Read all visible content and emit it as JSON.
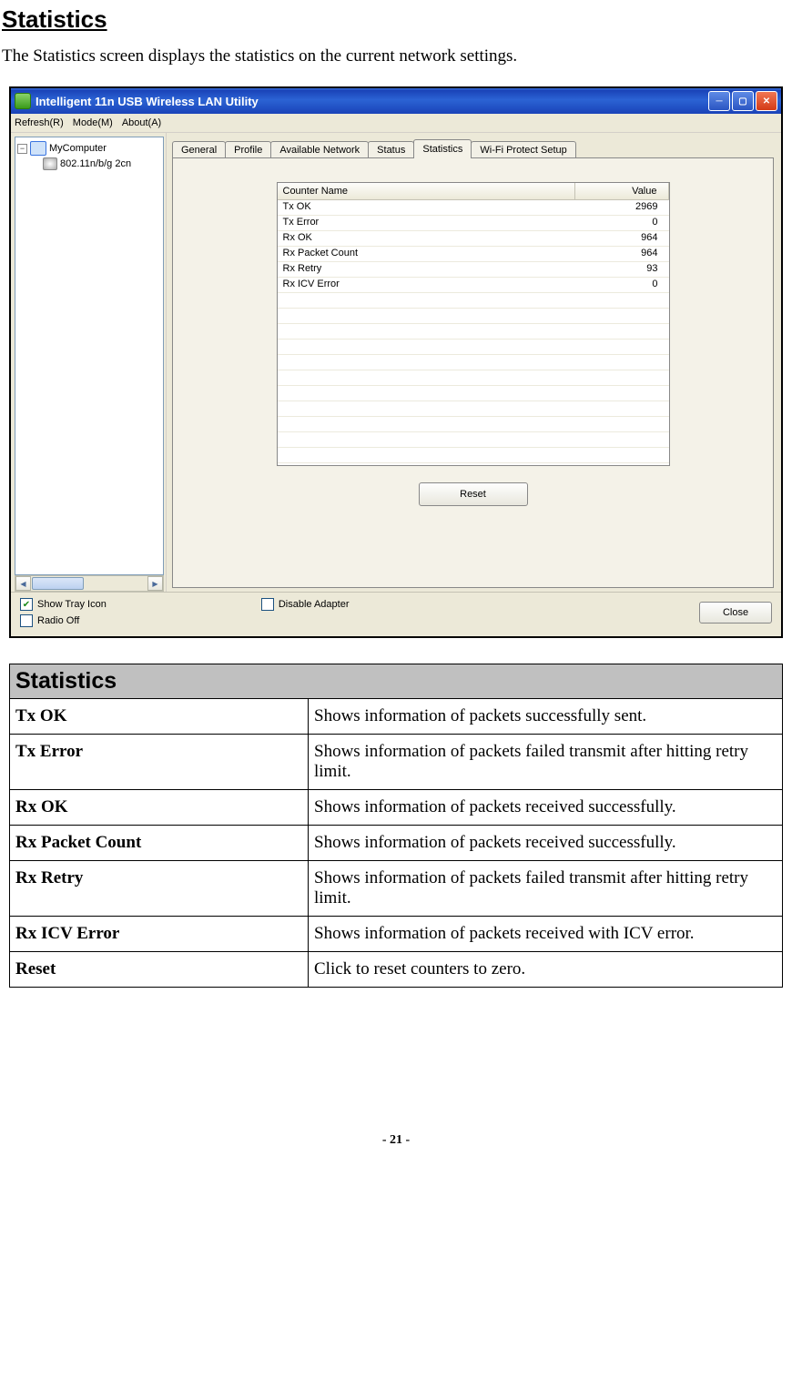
{
  "page": {
    "heading": "Statistics",
    "intro": "The Statistics screen displays the statistics on the current network settings.",
    "page_number": "- 21 -"
  },
  "window": {
    "title": "Intelligent 11n USB Wireless LAN Utility",
    "menu": {
      "refresh": "Refresh(R)",
      "mode": "Mode(M)",
      "about": "About(A)"
    },
    "tree": {
      "root": "MyComputer",
      "child": "802.11n/b/g 2cn"
    },
    "tabs": {
      "general": "General",
      "profile": "Profile",
      "available_network": "Available Network",
      "status": "Status",
      "statistics": "Statistics",
      "wps": "Wi-Fi Protect Setup"
    },
    "stats_table": {
      "header_name": "Counter Name",
      "header_value": "Value",
      "rows": [
        {
          "name": "Tx OK",
          "value": "2969"
        },
        {
          "name": "Tx Error",
          "value": "0"
        },
        {
          "name": "Rx OK",
          "value": "964"
        },
        {
          "name": "Rx Packet Count",
          "value": "964"
        },
        {
          "name": "Rx Retry",
          "value": "93"
        },
        {
          "name": "Rx ICV Error",
          "value": "0"
        }
      ]
    },
    "reset_button": "Reset",
    "checkboxes": {
      "show_tray": "Show Tray Icon",
      "radio_off": "Radio Off",
      "disable_adapter": "Disable Adapter"
    },
    "close_button": "Close"
  },
  "doc_table": {
    "title": "Statistics",
    "rows": [
      {
        "term": "Tx OK",
        "desc": "Shows information of packets successfully sent."
      },
      {
        "term": "Tx Error",
        "desc": "Shows information of packets failed transmit after hitting retry limit."
      },
      {
        "term": "Rx OK",
        "desc": "Shows information of packets received successfully."
      },
      {
        "term": "Rx Packet Count",
        "desc": "Shows information of packets received successfully."
      },
      {
        "term": "Rx Retry",
        "desc": "Shows information of packets failed transmit after hitting retry limit."
      },
      {
        "term": "Rx ICV Error",
        "desc": "Shows information of packets received with ICV error."
      },
      {
        "term": "Reset",
        "desc": "Click to reset counters to zero."
      }
    ]
  }
}
